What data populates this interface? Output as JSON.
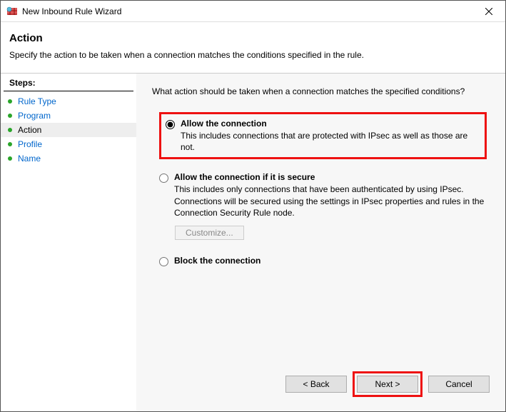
{
  "window": {
    "title": "New Inbound Rule Wizard"
  },
  "header": {
    "title": "Action",
    "description": "Specify the action to be taken when a connection matches the conditions specified in the rule."
  },
  "sidebar": {
    "title": "Steps:",
    "items": [
      {
        "label": "Rule Type",
        "current": false
      },
      {
        "label": "Program",
        "current": false
      },
      {
        "label": "Action",
        "current": true
      },
      {
        "label": "Profile",
        "current": false
      },
      {
        "label": "Name",
        "current": false
      }
    ]
  },
  "main": {
    "prompt": "What action should be taken when a connection matches the specified conditions?",
    "options": [
      {
        "title": "Allow the connection",
        "desc": "This includes connections that are protected with IPsec as well as those are not.",
        "selected": true,
        "highlighted": true
      },
      {
        "title": "Allow the connection if it is secure",
        "desc": "This includes only connections that have been authenticated by using IPsec.  Connections will be secured using the settings in IPsec properties and rules in the Connection Security Rule node.",
        "selected": false,
        "customize_label": "Customize...",
        "customize_enabled": false
      },
      {
        "title": "Block the connection",
        "desc": "",
        "selected": false
      }
    ]
  },
  "footer": {
    "back": "< Back",
    "next": "Next >",
    "cancel": "Cancel"
  }
}
